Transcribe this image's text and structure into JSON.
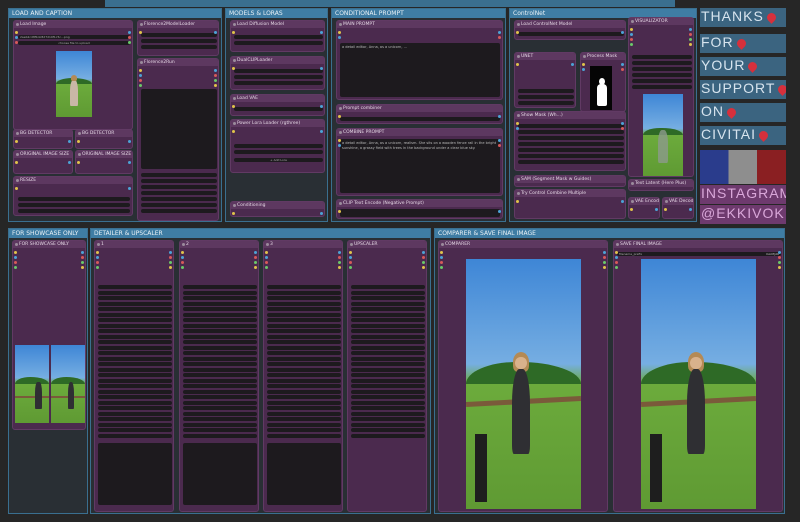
{
  "groups": {
    "load": "LOAD AND CAPTION",
    "models": "MODELS & LORAS",
    "cond": "CONDITIONAL PROMPT",
    "controlnet": "ControlNet",
    "showcase": "FOR SHOWCASE ONLY",
    "detailer": "DETAILER & UPSCALER",
    "compare": "COMPARER & SAVE FINAL IMAGE"
  },
  "nodes": {
    "load_image": "Load Image",
    "load_image_file": "2aeb2cd8fb4c8d7d19f1c5c…png",
    "load_image_btn": "choose file to upload",
    "bg_detector_a": "BG DETECTOR",
    "bg_detector_b": "BG DETECTOR",
    "orig_size_a": "ORIGINAL IMAGE SIZE",
    "orig_size_b": "ORIGINAL IMAGE SIZE",
    "resize": "RESIZE",
    "florence_loader": "Florence2ModelLoader",
    "florence_run": "Florence2Run",
    "diffusion_loader": "Load Diffusion Model",
    "dual_clip": "DualCLIPLoader",
    "load_vae": "Load VAE",
    "power_lora": "Power Lora Loader (rgthree)",
    "lora_add": "+ Add Lora",
    "cond_text": "Conditioning",
    "main_prompt": "MAIN PROMPT",
    "main_prompt_text": "a detail editor, Anna, as a unicorn, ...",
    "prompt_combiner": "Prompt combiner",
    "combine_prompt": "COMBINE PROMPT",
    "combine_prompt_text": "a detail editor, Anna, as a unicorn, realism. She sits on a wooden fence rail in the bright sunshine, a grassy field with trees in the background under a clear blue sky.",
    "clip_negative": "CLIP Text Encode (Negative Prompt)",
    "load_cn_model": "Load ControlNet Model",
    "union": "UNET",
    "process_mask": "Process Mask",
    "show_mask": "Show Mask (Wh...)",
    "sam_stage": "SAM (Segment Mask w Guides)",
    "cn_combine": "Try Control Combine Multiple",
    "visualizer": "VISUALIZATOR",
    "text_latent": "Text Latent (Here Plus)",
    "vae_encode": "VAE Encode",
    "vae_decode": "VAE Decode",
    "for_showcase_only": "FOR SHOWCASE ONLY",
    "det1": "1",
    "det2": "2",
    "det3": "3",
    "upscaler": "UPSCALER",
    "comparer": "COMPARER",
    "save_final": "SAVE FINAL IMAGE",
    "save_prefix": "filename_prefix",
    "save_prefix_val": "ComfyUI"
  },
  "tiles": {
    "l1": "THANKS",
    "l2": "FOR",
    "l3": "YOUR",
    "l4": "SUPPORT",
    "l5": "ON",
    "l6": "CIVITAI",
    "l7": "INSTAGRAM",
    "l8": "@EKKIVOK"
  },
  "colors": {
    "group": "#3f7da4",
    "node": "#4b2a4e",
    "tile": "#3b6480",
    "flag_blue": "#2a3c8c",
    "flag_grey": "#8e8e8e",
    "flag_red": "#8a1f22"
  }
}
